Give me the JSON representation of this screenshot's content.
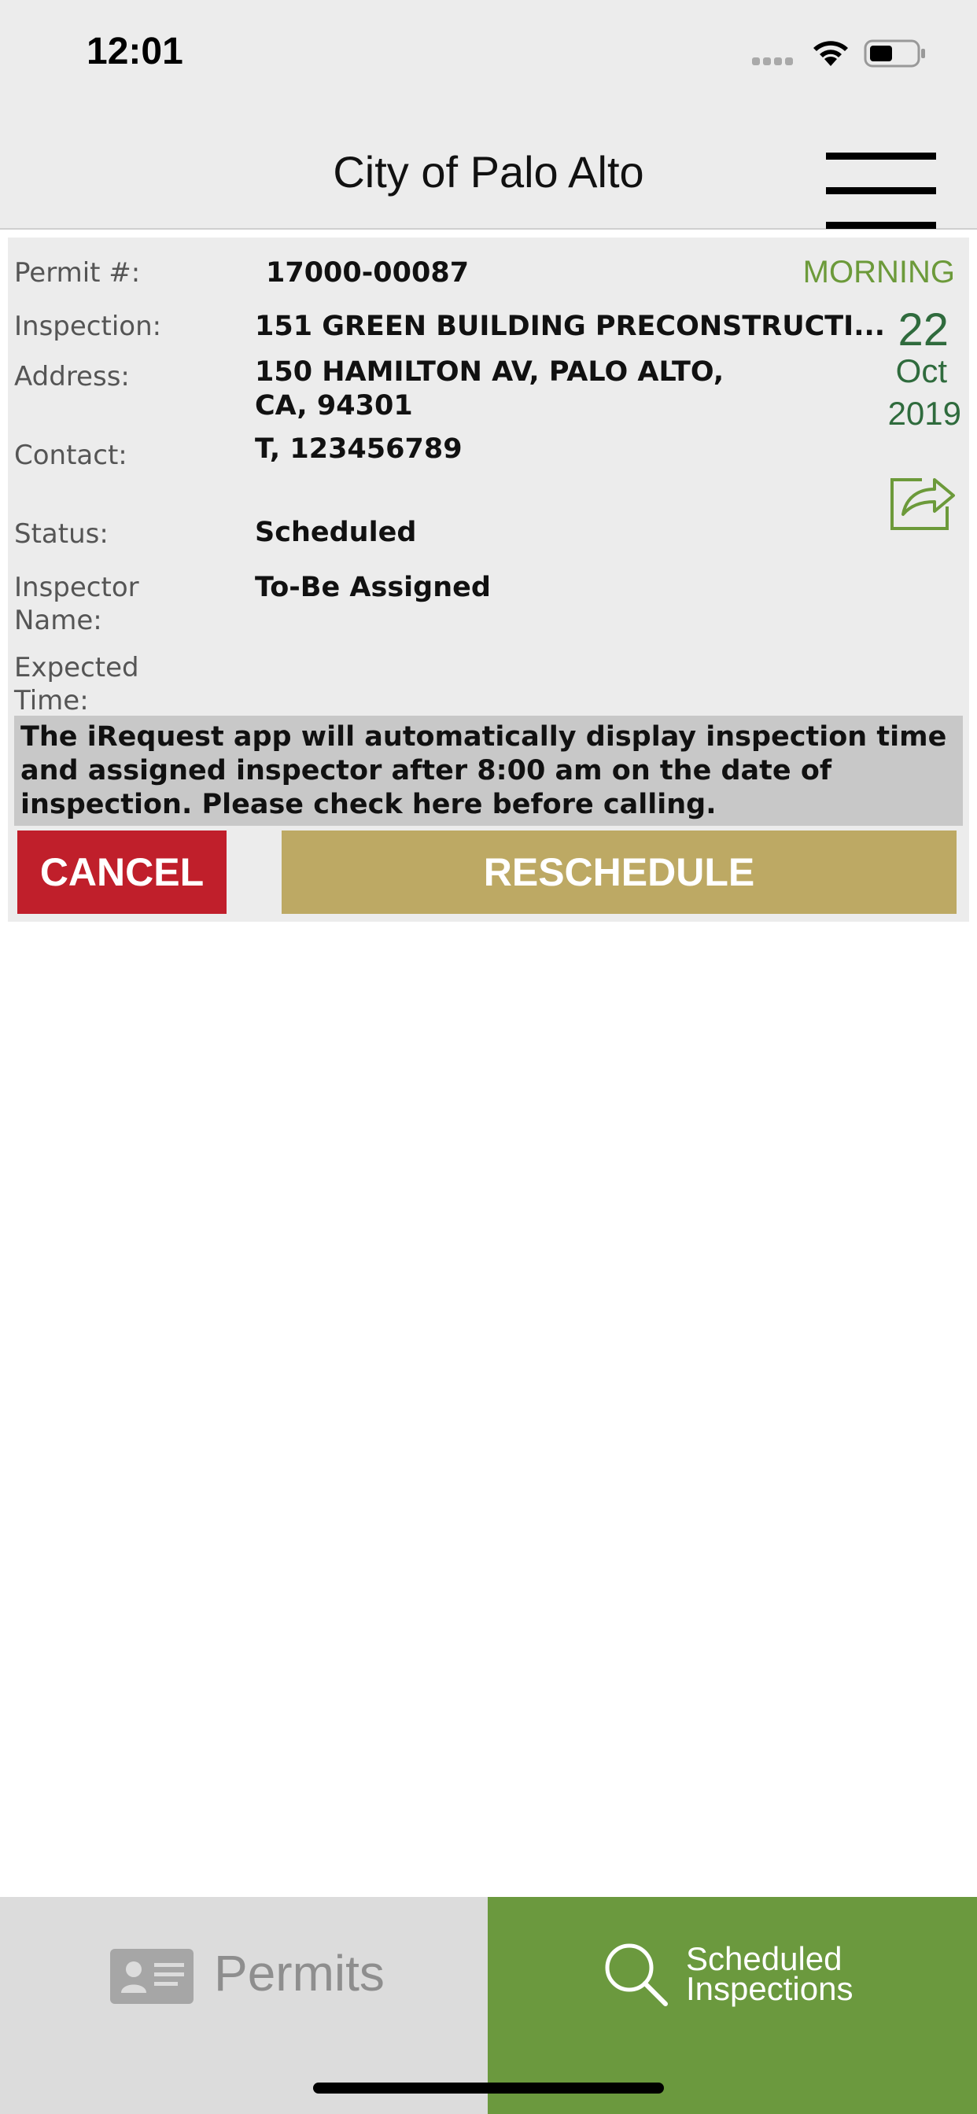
{
  "status_bar": {
    "time": "12:01"
  },
  "header": {
    "title": "City of Palo Alto"
  },
  "inspection": {
    "permit_label": "Permit #:",
    "permit_value": "17000-00087",
    "inspection_label": "Inspection:",
    "inspection_value": "151 GREEN BUILDING PRECONSTRUCTI...",
    "address_label": "Address:",
    "address_line1": "150 HAMILTON AV, PALO ALTO,",
    "address_line2": "CA, 94301",
    "contact_label": "Contact:",
    "contact_value": "T, 123456789",
    "status_label": "Status:",
    "status_value": "Scheduled",
    "inspector_label_1": "Inspector",
    "inspector_label_2": "Name:",
    "inspector_value": "To-Be Assigned",
    "expected_label_1": "Expected",
    "expected_label_2": "Time:",
    "period": "MORNING",
    "day": "22",
    "month": "Oct",
    "year": "2019",
    "notice": "The iRequest app will automatically display inspection time and assigned inspector after 8:00 am on the date of inspection. Please check here before calling.",
    "cancel_label": "CANCEL",
    "reschedule_label": "RESCHEDULE"
  },
  "tabs": {
    "permits_label": "Permits",
    "scheduled_line1": "Scheduled",
    "scheduled_line2": "Inspections"
  },
  "colors": {
    "accent_green": "#6b993e",
    "cancel_red": "#c01f2b",
    "reschedule_gold": "#bda964"
  }
}
